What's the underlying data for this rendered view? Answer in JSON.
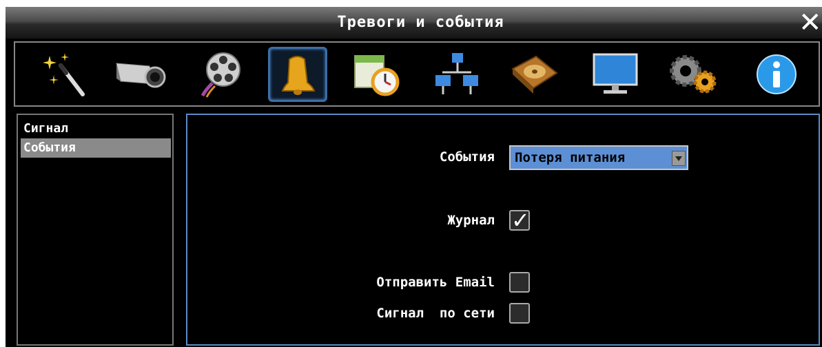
{
  "window": {
    "title": "Тревоги и события",
    "close_icon": "close-icon"
  },
  "toolbar": {
    "items": [
      {
        "name": "wizard",
        "icon": "magic-wand-icon"
      },
      {
        "name": "camera",
        "icon": "camera-icon"
      },
      {
        "name": "record",
        "icon": "film-reel-icon"
      },
      {
        "name": "alarm",
        "icon": "bell-icon",
        "active": true
      },
      {
        "name": "schedule",
        "icon": "calendar-clock-icon"
      },
      {
        "name": "network",
        "icon": "network-icon"
      },
      {
        "name": "storage",
        "icon": "hard-disk-icon"
      },
      {
        "name": "display",
        "icon": "monitor-icon"
      },
      {
        "name": "system",
        "icon": "gears-icon"
      },
      {
        "name": "info",
        "icon": "info-icon"
      }
    ]
  },
  "sidebar": {
    "items": [
      {
        "label": "Сигнал",
        "selected": false
      },
      {
        "label": "События",
        "selected": true
      }
    ]
  },
  "form": {
    "events_label": "События",
    "events_value": "Потеря питания",
    "log_label": "Журнал",
    "log_checked": true,
    "email_label": "Отправить Email",
    "email_checked": false,
    "net_alarm_label": "Сигнал  по сети",
    "net_alarm_checked": false
  },
  "colors": {
    "accent": "#5d8fd4",
    "active_border": "#3b6fa8"
  }
}
